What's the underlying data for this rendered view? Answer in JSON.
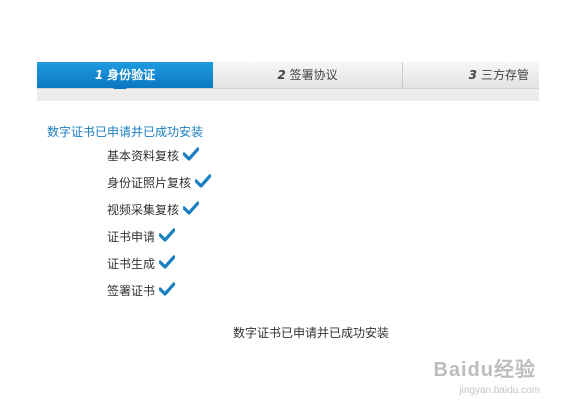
{
  "steps": [
    {
      "number": "1",
      "label": "身份验证"
    },
    {
      "number": "2",
      "label": "签署协议"
    },
    {
      "number": "3",
      "label": "三方存管"
    }
  ],
  "headline": "数字证书已申请并已成功安装",
  "checklist": [
    "基本资料复核",
    "身份证照片复核",
    "视频采集复核",
    "证书申请",
    "证书生成",
    "签署证书"
  ],
  "footer_message": "数字证书已申请并已成功安装",
  "watermark": {
    "brand": "Baidu经验",
    "url": "jingyan.baidu.com"
  },
  "icons": {
    "check": "checkmark-icon"
  },
  "colors": {
    "accent": "#0a78c2",
    "check": "#1a7fc0"
  }
}
